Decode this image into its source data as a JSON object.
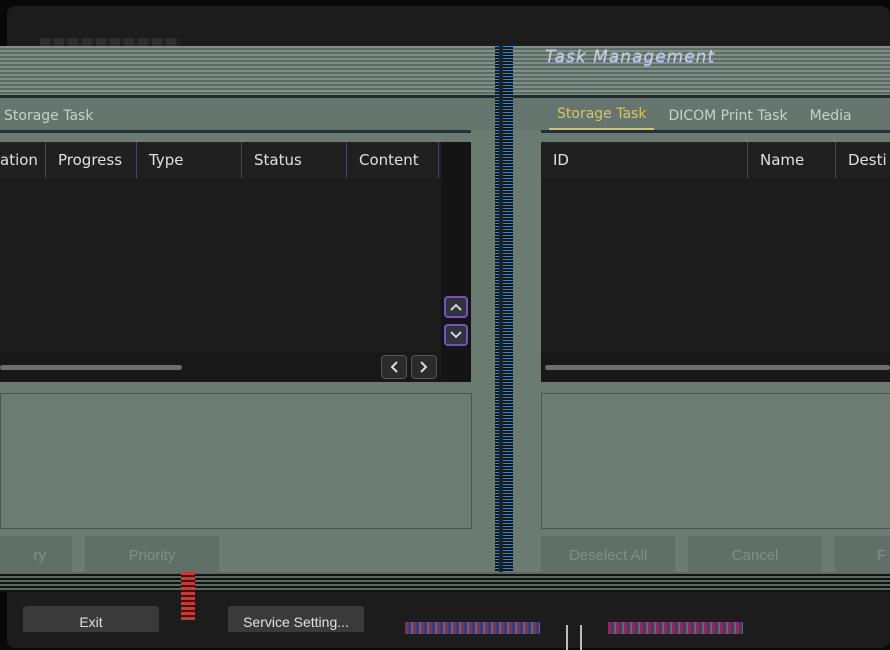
{
  "window": {
    "title": "Task Management"
  },
  "left_panel": {
    "tabs": [
      {
        "label": "Storage Task",
        "active": false
      }
    ],
    "columns": [
      "ation",
      "Progress",
      "Type",
      "Status",
      "Content"
    ],
    "buttons": {
      "retry": "ry",
      "priority": "Priority"
    }
  },
  "right_panel": {
    "tabs": [
      {
        "label": "Storage Task",
        "active": true
      },
      {
        "label": "DICOM Print Task",
        "active": false
      },
      {
        "label": "Media",
        "active": false
      }
    ],
    "columns": [
      "ID",
      "Name",
      "Desti"
    ],
    "buttons": {
      "deselect_all": "Deselect All",
      "cancel": "Cancel",
      "partial": "F"
    }
  },
  "footer": {
    "exit": "Exit",
    "service_setting": "Service Setting..."
  },
  "colors": {
    "panel": "#6b7b72",
    "active_tab": "#d6c46a",
    "scroll_button_border": "#7a4fc4"
  },
  "icons": {
    "up": "chevron-up-icon",
    "down": "chevron-down-icon",
    "left": "chevron-left-icon",
    "right": "chevron-right-icon"
  }
}
